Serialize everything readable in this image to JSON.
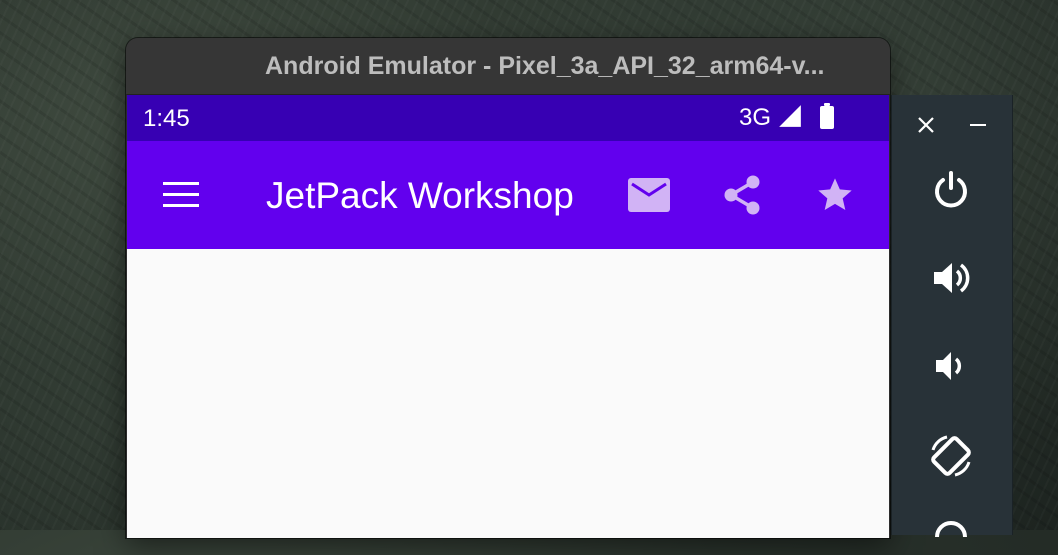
{
  "window": {
    "title": "Android Emulator - Pixel_3a_API_32_arm64-v..."
  },
  "status_bar": {
    "time": "1:45",
    "network": "3G",
    "icons": [
      "signal-icon",
      "battery-icon"
    ]
  },
  "app_bar": {
    "title": "JetPack Workshop",
    "nav_icon": "menu-icon",
    "actions": [
      "mail-icon",
      "share-icon",
      "star-icon"
    ]
  },
  "emulator_controls": {
    "buttons": [
      "close-icon",
      "minimize-icon",
      "power-icon",
      "volume-up-icon",
      "volume-down-icon",
      "rotate-icon"
    ]
  },
  "colors": {
    "status_bar": "#3700b3",
    "app_bar": "#6200ee",
    "action_icon_tint": "#d1b3f5",
    "content_background": "#fafafa",
    "toolbar_background": "#283238"
  }
}
